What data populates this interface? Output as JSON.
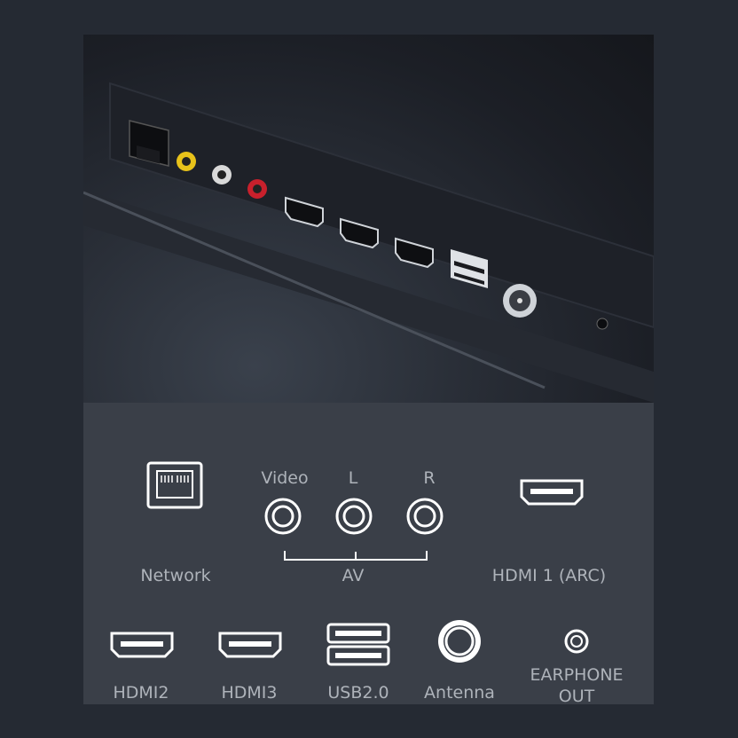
{
  "ports": {
    "network": "Network",
    "video": "Video",
    "left": "L",
    "right": "R",
    "av": "AV",
    "hdmi1": "HDMI 1 (ARC)",
    "hdmi2": "HDMI2",
    "hdmi3": "HDMI3",
    "usb": "USB2.0",
    "antenna": "Antenna",
    "earphone_line1": "EARPHONE",
    "earphone_line2": "OUT"
  },
  "colors": {
    "rca_video": "#e8c21a",
    "rca_left": "#d9d9d9",
    "rca_right": "#c8202c"
  },
  "icons": [
    "ethernet-icon",
    "rca-icon",
    "hdmi-icon",
    "usb-icon",
    "antenna-icon",
    "earphone-jack-icon"
  ]
}
